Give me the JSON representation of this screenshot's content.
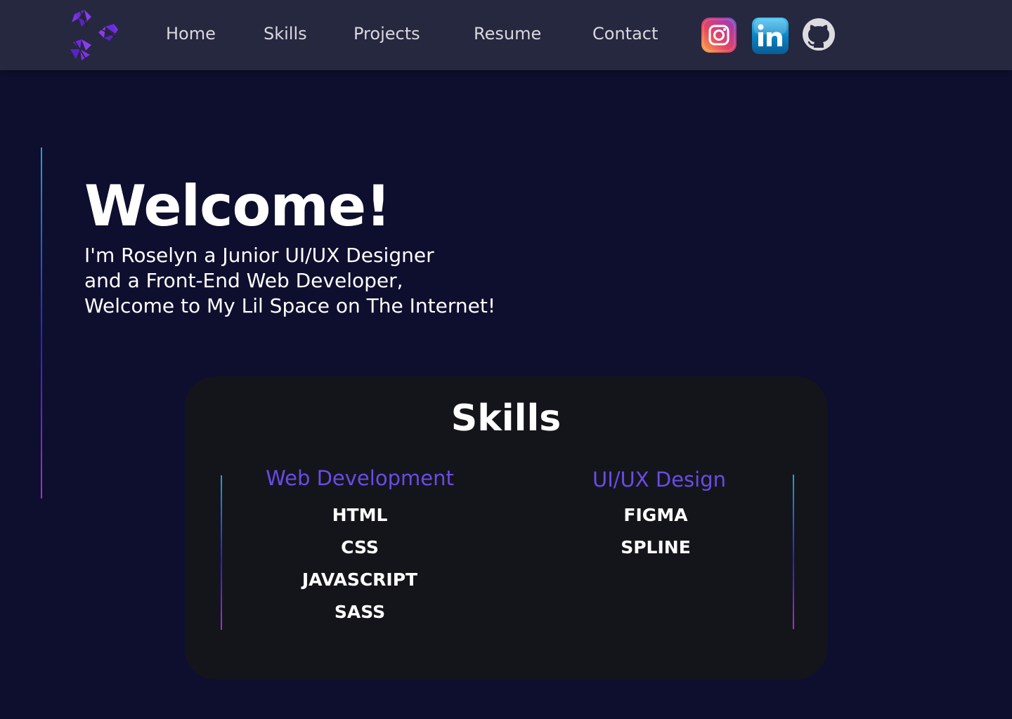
{
  "nav": {
    "links": [
      "Home",
      "Skills",
      "Projects",
      "Resume",
      "Contact"
    ],
    "social": [
      {
        "name": "instagram-icon"
      },
      {
        "name": "linkedin-icon"
      },
      {
        "name": "github-icon"
      }
    ]
  },
  "hero": {
    "title": "Welcome!",
    "lines": [
      "I'm Roselyn a Junior UI/UX Designer",
      "and a Front-End Web Developer,",
      "Welcome to My Lil Space on The Internet!"
    ]
  },
  "skills": {
    "title": "Skills",
    "columns": [
      {
        "heading": "Web Development",
        "items": [
          "HTML",
          "CSS",
          "JAVASCRIPT",
          "SASS"
        ]
      },
      {
        "heading": "UI/UX Design",
        "items": [
          "FIGMA",
          "SPLINE"
        ]
      }
    ]
  },
  "colors": {
    "background": "#0e0f2e",
    "navbar": "#262840",
    "card": "#14151b",
    "accent": "#6a4be6"
  }
}
